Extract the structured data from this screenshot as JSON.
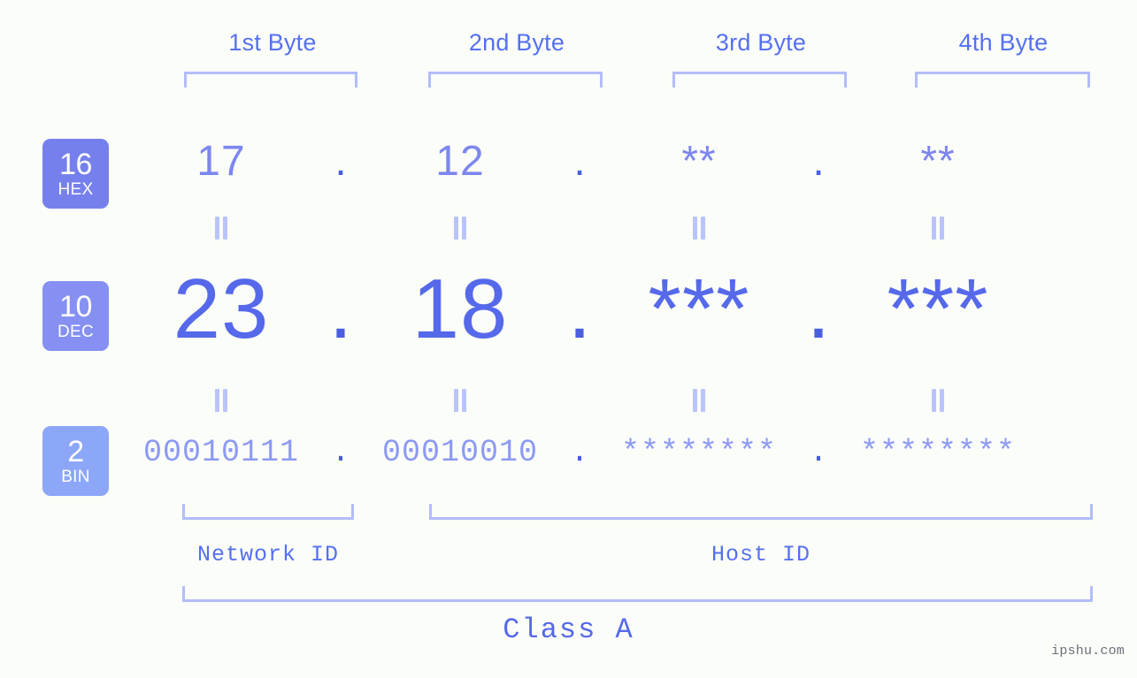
{
  "meta": {
    "background_color": "#fbfdf9",
    "accent_color": "#5569ea",
    "light_accent_color": "#b2bdfa",
    "watermark": "ipshu.com"
  },
  "byte_headers": [
    {
      "label": "1st Byte"
    },
    {
      "label": "2nd Byte"
    },
    {
      "label": "3rd Byte"
    },
    {
      "label": "4th Byte"
    }
  ],
  "bases": [
    {
      "num": "16",
      "name": "HEX",
      "color": "#7680ec"
    },
    {
      "num": "10",
      "name": "DEC",
      "color": "#8590f2"
    },
    {
      "num": "2",
      "name": "BIN",
      "color": "#8ca6f8"
    }
  ],
  "rows": {
    "hex": {
      "values": [
        "17",
        "12",
        "**",
        "**"
      ],
      "separator": "."
    },
    "dec": {
      "values": [
        "23",
        "18",
        "***",
        "***"
      ],
      "separator": "."
    },
    "bin": {
      "values": [
        "00010111",
        "00010010",
        "********",
        "********"
      ],
      "separator": "."
    }
  },
  "equality_marks": {
    "glyph": "=",
    "count_per_row": 4
  },
  "segments": {
    "network_id": "Network ID",
    "host_id": "Host ID"
  },
  "class": {
    "label": "Class A"
  }
}
